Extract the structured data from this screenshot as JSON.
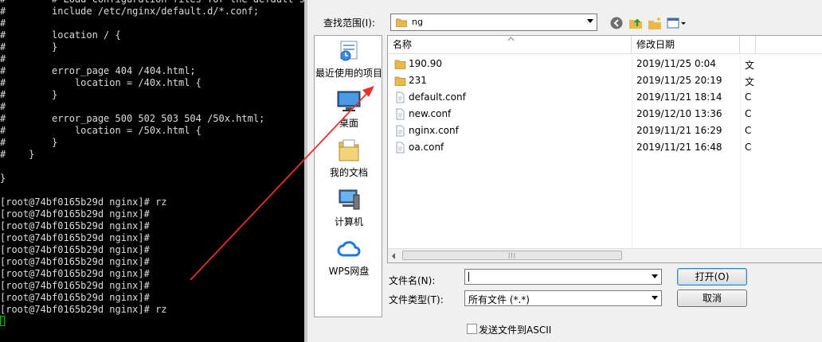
{
  "terminal": {
    "lines": [
      "#        # Load configuration files for the default se",
      "#        include /etc/nginx/default.d/*.conf;",
      "#",
      "#        location / {",
      "#        }",
      "#",
      "#        error_page 404 /404.html;",
      "#            location = /40x.html {",
      "#        }",
      "#",
      "#        error_page 500 502 503 504 /50x.html;",
      "#            location = /50x.html {",
      "#        }",
      "#    }",
      "",
      "}",
      "",
      "[root@74bf0165b29d nginx]# rz",
      "[root@74bf0165b29d nginx]#",
      "[root@74bf0165b29d nginx]#",
      "[root@74bf0165b29d nginx]#",
      "[root@74bf0165b29d nginx]#",
      "[root@74bf0165b29d nginx]#",
      "[root@74bf0165b29d nginx]#",
      "[root@74bf0165b29d nginx]#",
      "[root@74bf0165b29d nginx]#",
      "[root@74bf0165b29d nginx]# rz"
    ]
  },
  "dialog": {
    "look_in_label": "查找范围(I):",
    "look_in_value": "ng",
    "places": [
      {
        "label": "最近使用的项目",
        "icon": "recent-items-icon"
      },
      {
        "label": "桌面",
        "icon": "desktop-icon"
      },
      {
        "label": "我的文档",
        "icon": "documents-icon"
      },
      {
        "label": "计算机",
        "icon": "computer-icon"
      },
      {
        "label": "WPS网盘",
        "icon": "cloud-icon"
      }
    ],
    "columns": {
      "name": "名称",
      "date": "修改日期"
    },
    "files": [
      {
        "name": "190.90",
        "date": "2019/11/25 0:04",
        "type": "folder",
        "ext": "文"
      },
      {
        "name": "231",
        "date": "2019/11/25 20:19",
        "type": "folder",
        "ext": "文"
      },
      {
        "name": "default.conf",
        "date": "2019/11/21 18:14",
        "type": "file",
        "ext": "C"
      },
      {
        "name": "new.conf",
        "date": "2019/12/10 13:36",
        "type": "file",
        "ext": "C"
      },
      {
        "name": "nginx.conf",
        "date": "2019/11/21 16:29",
        "type": "file",
        "ext": "C"
      },
      {
        "name": "oa.conf",
        "date": "2019/11/21 16:48",
        "type": "file",
        "ext": "C"
      }
    ],
    "filename_label": "文件名(N):",
    "filename_value": "",
    "filetype_label": "文件类型(T):",
    "filetype_value": "所有文件 (*.*)",
    "open_button": "打开(O)",
    "cancel_button": "取消",
    "ascii_checkbox_label": "发送文件到ASCII",
    "ascii_checked": false
  },
  "colors": {
    "terminal_bg": "#000000",
    "terminal_fg": "#dcdcdc",
    "cursor": "#00c000",
    "annotation_arrow": "#e8302a",
    "folder": "#e8b84a"
  }
}
